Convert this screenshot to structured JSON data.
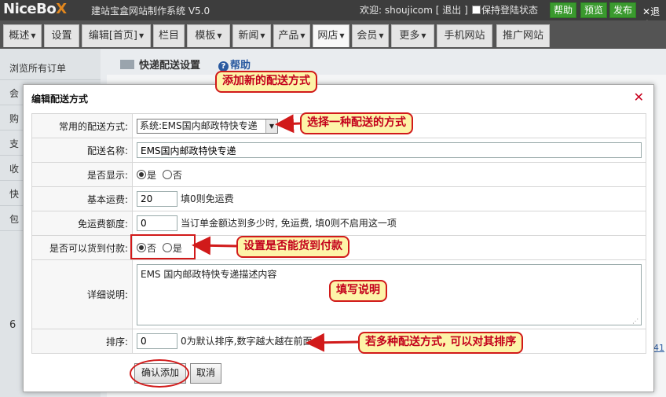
{
  "header": {
    "logo": [
      "NiceBo",
      "X"
    ],
    "system_name": "建站宝盒网站制作系统 V5.0",
    "welcome": "欢迎: shoujicom [ 退出 ]",
    "keep_login": "保持登陆状态",
    "buttons": [
      "帮助",
      "预览",
      "发布"
    ],
    "exit": "退出"
  },
  "nav": {
    "tabs": [
      {
        "label": "概述",
        "caret": true
      },
      {
        "label": "设置",
        "caret": false
      },
      {
        "label": "编辑[首页]",
        "caret": true
      },
      {
        "label": "栏目",
        "caret": false
      },
      {
        "label": "模板",
        "caret": true
      },
      {
        "label": "新闻",
        "caret": true
      },
      {
        "label": "产品",
        "caret": true
      },
      {
        "label": "网店",
        "caret": true
      },
      {
        "label": "会员",
        "caret": true
      },
      {
        "label": "更多",
        "caret": true
      },
      {
        "label": "手机网站",
        "caret": false
      },
      {
        "label": "推广网站",
        "caret": false
      }
    ],
    "active": "网店"
  },
  "sidebar": {
    "items": [
      "浏览所有订单",
      "会",
      "购",
      "支",
      "收",
      "快",
      "包"
    ]
  },
  "page": {
    "title": "快递配送设置",
    "help": "帮助",
    "section_icon_label": "6",
    "right_link": "41"
  },
  "dialog": {
    "title": "编辑配送方式",
    "close": "✕",
    "fields": {
      "common_method_label": "常用的配送方式:",
      "common_method_value": "系统:EMS国内邮政特快专递",
      "name_label": "配送名称:",
      "name_value": "EMS国内邮政特快专递",
      "show_label": "是否显示:",
      "show_yes": "是",
      "show_no": "否",
      "show_selected": "是",
      "base_fee_label": "基本运费:",
      "base_fee_value": "20",
      "base_fee_hint": "填0则免运费",
      "free_amount_label": "免运费额度:",
      "free_amount_value": "0",
      "free_amount_hint": "当订单金额达到多少时, 免运费, 填0则不启用这一项",
      "cod_label": "是否可以货到付款:",
      "cod_no": "否",
      "cod_yes": "是",
      "cod_selected": "否",
      "desc_label": "详细说明:",
      "desc_value": "EMS 国内邮政特快专递描述内容",
      "sort_label": "排序:",
      "sort_value": "0",
      "sort_hint": "0为默认排序,数字越大越在前面"
    },
    "confirm": "确认添加",
    "cancel": "取消"
  },
  "annotations": {
    "add_new": "添加新的配送方式",
    "choose_method": "选择一种配送的方式",
    "set_cod": "设置是否能货到付款",
    "fill_desc": "填写说明",
    "sort_multi": "若多种配送方式, 可以对其排序"
  },
  "colors": {
    "annotation_red": "#d11a1a",
    "annotation_fill": "#fdf4a8",
    "header_bg": "#3d3d3d",
    "button_green": "#3a9a2e"
  }
}
